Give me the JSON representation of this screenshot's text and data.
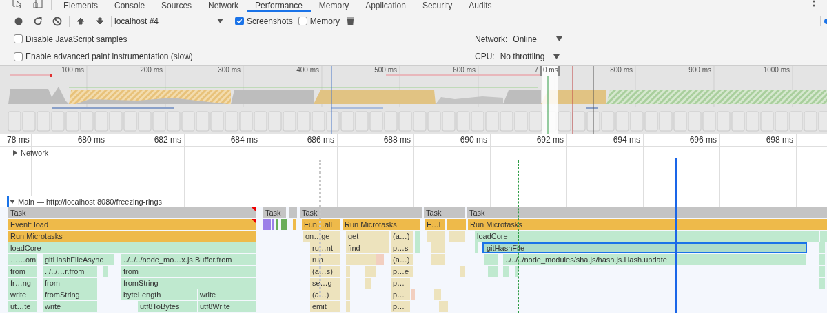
{
  "tabs": [
    {
      "label": "Elements",
      "selected": false
    },
    {
      "label": "Console",
      "selected": false
    },
    {
      "label": "Sources",
      "selected": false
    },
    {
      "label": "Network",
      "selected": false
    },
    {
      "label": "Performance",
      "selected": true
    },
    {
      "label": "Memory",
      "selected": false
    },
    {
      "label": "Application",
      "selected": false
    },
    {
      "label": "Security",
      "selected": false
    },
    {
      "label": "Audits",
      "selected": false
    }
  ],
  "toolbar": {
    "profile": "localhost #4",
    "options": [
      {
        "label": "Screenshots",
        "checked": true
      },
      {
        "label": "Memory",
        "checked": false
      }
    ]
  },
  "settings": [
    {
      "label": "Disable JavaScript samples",
      "checked": false
    },
    {
      "label": "Enable advanced paint instrumentation (slow)",
      "checked": false
    }
  ],
  "throttling": [
    {
      "label": "Network:",
      "value": "Online"
    },
    {
      "label": "CPU:",
      "value": "No throttling"
    }
  ],
  "overview": {
    "ticks": [
      "100 ms",
      "200 ms",
      "300 ms",
      "400 ms",
      "500 ms",
      "600 ms",
      "7",
      "0 ms",
      "800 ms",
      "900 ms",
      "1000 ms"
    ]
  },
  "ruler": {
    "ticks": [
      "78 ms",
      "680 ms",
      "682 ms",
      "684 ms",
      "686 ms",
      "688 ms",
      "690 ms",
      "692 ms",
      "694 ms",
      "696 ms",
      "698 ms"
    ]
  },
  "network_track": {
    "label": "Network",
    "expanded": false
  },
  "main_track": {
    "title": "Main — http://localhost:8080/freezing-rings",
    "expanded": true,
    "lanes": [
      {
        "blocks": [
          {
            "kind": "task",
            "text": "Task",
            "warning": true
          },
          {
            "kind": "task",
            "text": "Task"
          },
          {
            "kind": "task"
          },
          {
            "kind": "task",
            "text": "Task"
          },
          {
            "kind": "task",
            "text": "Task"
          },
          {
            "kind": "task",
            "text": "Task"
          }
        ]
      },
      {
        "blocks": [
          {
            "kind": "event",
            "text": "Event: load",
            "warning": true
          },
          {
            "kind": "render"
          },
          {
            "kind": "render"
          },
          {
            "kind": "render"
          },
          {
            "kind": "paint"
          },
          {
            "kind": "paint"
          },
          {
            "kind": "event"
          },
          {
            "kind": "event",
            "text": "Fun…all"
          },
          {
            "kind": "event",
            "text": "Run Microtasks"
          },
          {
            "kind": "event",
            "text": "F…l"
          },
          {
            "kind": "event"
          },
          {
            "kind": "event",
            "text": "Run Microtasks"
          }
        ]
      },
      {
        "blocks": [
          {
            "kind": "event",
            "text": "Run Microtasks"
          },
          {
            "kind": "native",
            "text": "on…ge"
          },
          {
            "kind": "native",
            "text": "get"
          },
          {
            "kind": "native",
            "text": "(a…)"
          },
          {
            "kind": "js"
          },
          {
            "kind": "native"
          },
          {
            "kind": "native"
          },
          {
            "kind": "js",
            "text": "loadCore"
          },
          {
            "kind": "js"
          }
        ]
      },
      {
        "blocks": [
          {
            "kind": "js",
            "text": "loadCore"
          },
          {
            "kind": "native",
            "text": "ru…nt"
          },
          {
            "kind": "native",
            "text": "find"
          },
          {
            "kind": "native",
            "text": "p…s"
          },
          {
            "kind": "js"
          },
          {
            "kind": "native"
          },
          {
            "kind": "js"
          },
          {
            "kind": "js",
            "text": "gitHashFile",
            "selected": true
          },
          {
            "kind": "js"
          }
        ]
      },
      {
        "blocks": [
          {
            "kind": "js",
            "text": "……om"
          },
          {
            "kind": "js",
            "text": "gitHashFileAsync"
          },
          {
            "kind": "js",
            "text": "../../../node_mo…x.js.Buffer.from"
          },
          {
            "kind": "native",
            "text": "run"
          },
          {
            "kind": "native"
          },
          {
            "kind": "gc"
          },
          {
            "kind": "native",
            "text": "(a…)"
          },
          {
            "kind": "native"
          },
          {
            "kind": "js"
          },
          {
            "kind": "js",
            "text": "../../../node_modules/sha.js/hash.js.Hash.update"
          },
          {
            "kind": "js"
          }
        ]
      },
      {
        "blocks": [
          {
            "kind": "js",
            "text": "from"
          },
          {
            "kind": "js",
            "text": "../../…r.from"
          },
          {
            "kind": "js"
          },
          {
            "kind": "js",
            "text": "from"
          },
          {
            "kind": "native",
            "text": "(a…s)"
          },
          {
            "kind": "native"
          },
          {
            "kind": "native"
          },
          {
            "kind": "native",
            "text": "p…e"
          },
          {
            "kind": "native"
          },
          {
            "kind": "js"
          },
          {
            "kind": "js"
          },
          {
            "kind": "js"
          },
          {
            "kind": "js"
          }
        ]
      },
      {
        "blocks": [
          {
            "kind": "js",
            "text": "fr…ng"
          },
          {
            "kind": "js",
            "text": "from"
          },
          {
            "kind": "js",
            "text": "fromString"
          },
          {
            "kind": "native",
            "text": "se…g"
          },
          {
            "kind": "native"
          },
          {
            "kind": "native"
          },
          {
            "kind": "native",
            "text": "p…"
          },
          {
            "kind": "js"
          }
        ]
      },
      {
        "blocks": [
          {
            "kind": "js",
            "text": "write"
          },
          {
            "kind": "js",
            "text": "fromString"
          },
          {
            "kind": "js",
            "text": "byteLength"
          },
          {
            "kind": "js",
            "text": "write"
          },
          {
            "kind": "native",
            "text": "(a…)"
          },
          {
            "kind": "native"
          },
          {
            "kind": "native",
            "text": "p…"
          },
          {
            "kind": "gc"
          },
          {
            "kind": "native"
          }
        ]
      },
      {
        "blocks": [
          {
            "kind": "js",
            "text": "ut…te"
          },
          {
            "kind": "js",
            "text": "write"
          },
          {
            "kind": "js",
            "text": "utf8ToBytes"
          },
          {
            "kind": "js",
            "text": "utf8Write"
          },
          {
            "kind": "native",
            "text": "emit"
          },
          {
            "kind": "native"
          },
          {
            "kind": "native",
            "text": "p…"
          },
          {
            "kind": "native"
          }
        ]
      }
    ]
  }
}
